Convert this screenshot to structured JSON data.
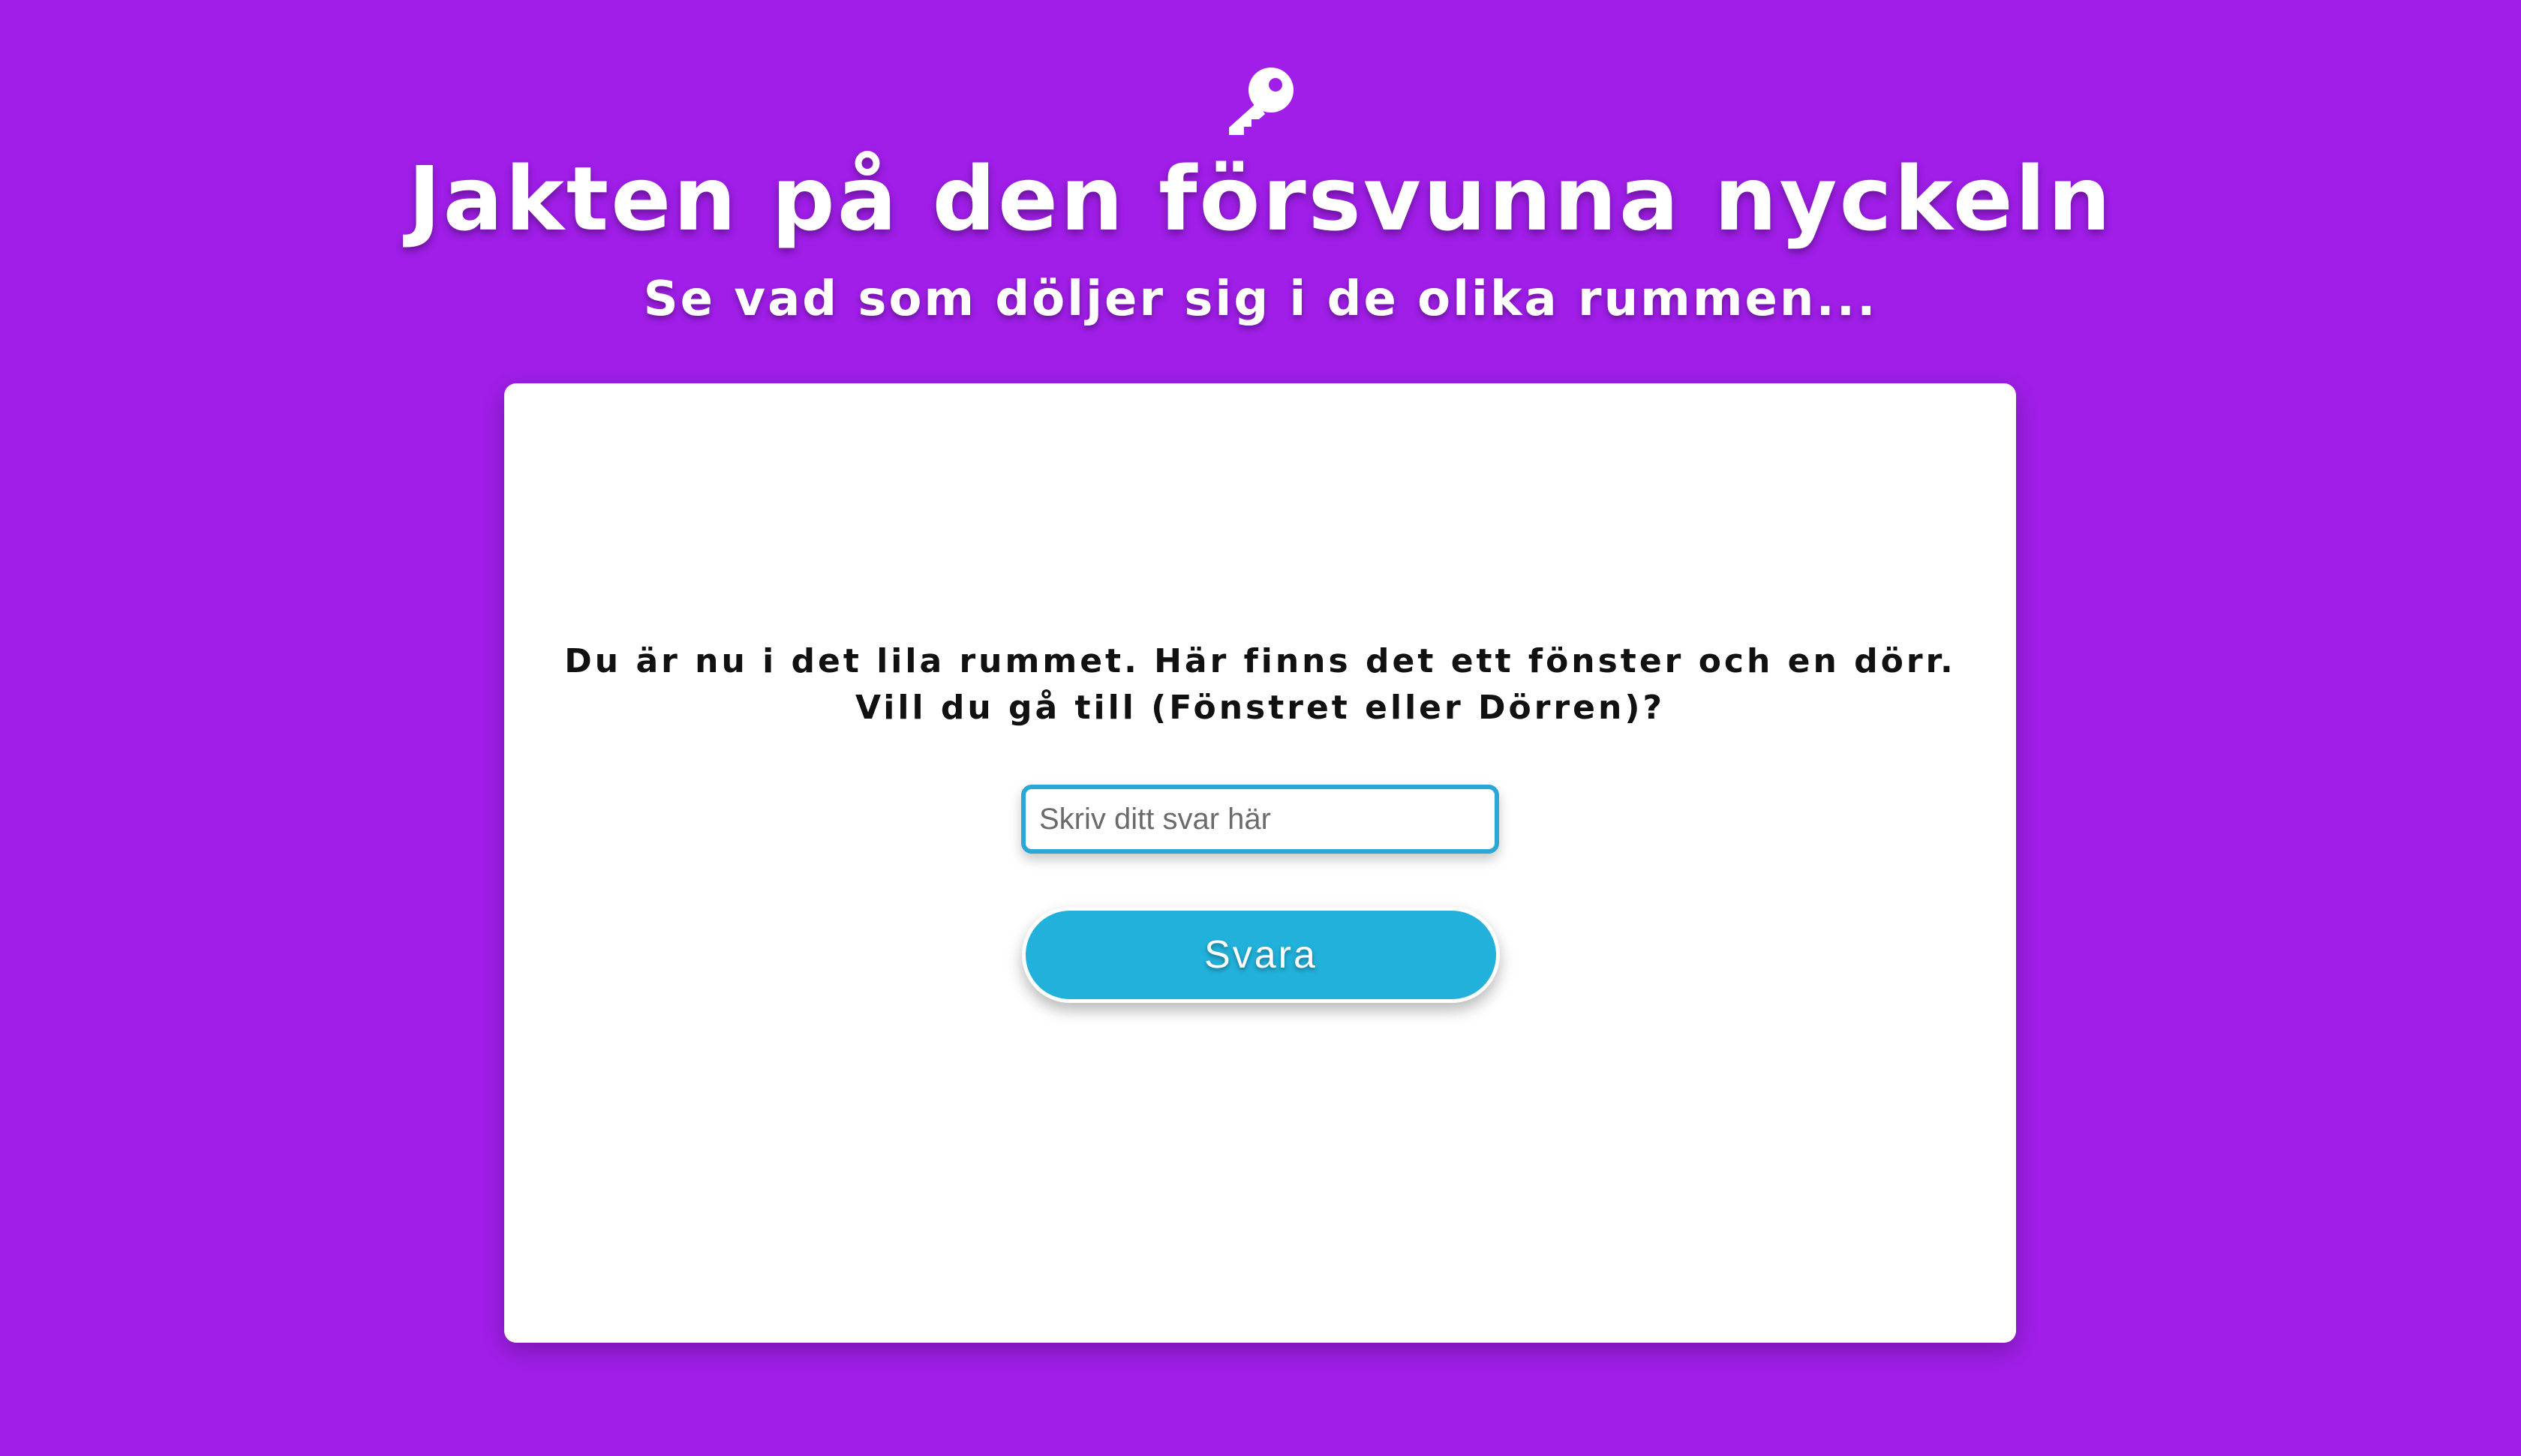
{
  "header": {
    "icon": "key-icon",
    "title": "Jakten på den försvunna nyckeln",
    "subtitle": "Se vad som döljer sig i de olika rummen..."
  },
  "card": {
    "question": "Du är nu i det lila rummet. Här finns det ett fönster och en dörr. Vill du gå till (Fönstret eller Dörren)?",
    "answer_input": {
      "value": "",
      "placeholder": "Skriv ditt svar här"
    },
    "submit_label": "Svara"
  },
  "colors": {
    "background": "#a01ee8",
    "card": "#ffffff",
    "accent": "#22b1da",
    "input_border": "#2aa7d6",
    "text": "#111111"
  }
}
